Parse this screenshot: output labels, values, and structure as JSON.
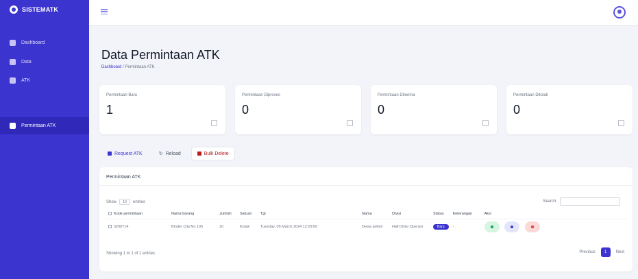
{
  "app": {
    "brand": "SISTEMATK"
  },
  "sidebar": {
    "items": [
      {
        "label": "Dashboard"
      },
      {
        "label": "Data"
      },
      {
        "label": "ATK"
      },
      {
        "label": "Permintaan ATK"
      }
    ]
  },
  "page": {
    "title": "Data Permintaan ATK",
    "breadcrumb_home": "Dashboard",
    "breadcrumb_sep": " / ",
    "breadcrumb_current": "Permintaan ATK"
  },
  "cards": [
    {
      "label": "Permintaan Baru",
      "value": "1"
    },
    {
      "label": "Permintaan Diproses",
      "value": "0"
    },
    {
      "label": "Permintaan Diterima",
      "value": "0"
    },
    {
      "label": "Permintaan Ditolak",
      "value": "0"
    }
  ],
  "actions": {
    "request": "Request ATK",
    "reload": "Reload",
    "bulk_delete": "Bulk Delete"
  },
  "panel": {
    "title": "Permintaan ATK",
    "show": "Show",
    "entries_value": "10",
    "entries": "entries",
    "search_label": "Search:",
    "showing": "Showing 1 to 1 of 1 entries",
    "prev": "Previous",
    "page": "1",
    "next": "Next"
  },
  "table": {
    "headers": [
      "Kode permintaan",
      "Nama barang",
      "Jumlah",
      "Satuan",
      "Tgl",
      "Nama",
      "Divisi",
      "Status",
      "Keterangan",
      "Aksi"
    ],
    "row": {
      "kode": "3200714",
      "nama_barang": "Binder Clip No 105",
      "jumlah": "10",
      "satuan": "Kotak",
      "tgl": "Tuesday, 05 March 2024 12:29:00",
      "nama": "Dewa admin",
      "divisi": "Hall Divisi Operasi",
      "status": "Baru",
      "keterangan": "-"
    }
  },
  "colors": {
    "primary": "#3c34cf",
    "background": "#f3f4f9"
  }
}
